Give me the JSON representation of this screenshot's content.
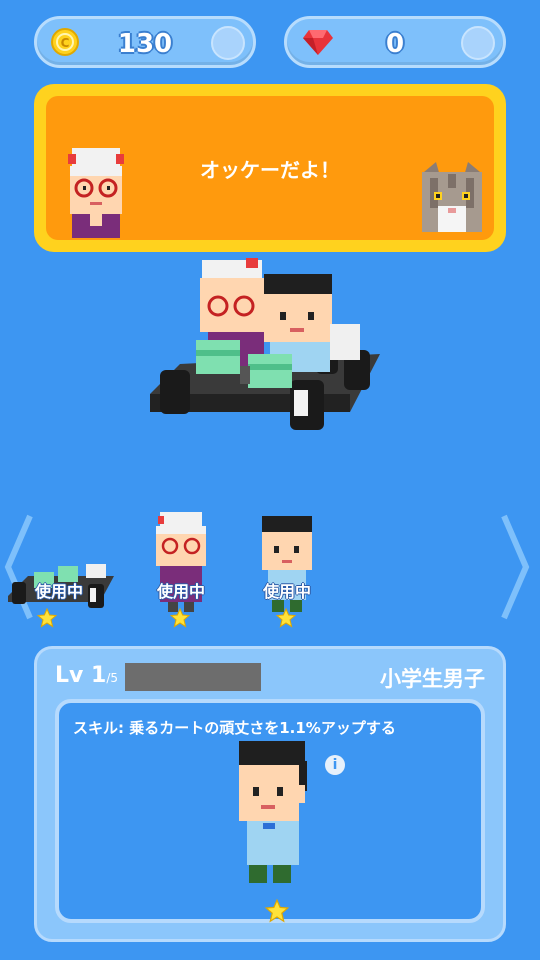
{
  "currency": {
    "coins": "130",
    "gems": "0"
  },
  "banner": {
    "message": "オッケーだよ！"
  },
  "characters": [
    {
      "name": "kart",
      "badge": "使用中"
    },
    {
      "name": "grandma",
      "badge": "使用中"
    },
    {
      "name": "boy",
      "badge": "使用中"
    }
  ],
  "info": {
    "level_label": "Lv 1",
    "level_max": "/5",
    "level_progress": 0,
    "character_name": "小学生男子",
    "skill": "スキル: 乗るカートの頑丈さを1.1%アップする",
    "info_glyph": "i"
  },
  "colors": {
    "background": "#3d96f2",
    "banner_outer": "#ffd21e",
    "banner_inner": "#ff9a0d",
    "star": "#ffe23a"
  }
}
